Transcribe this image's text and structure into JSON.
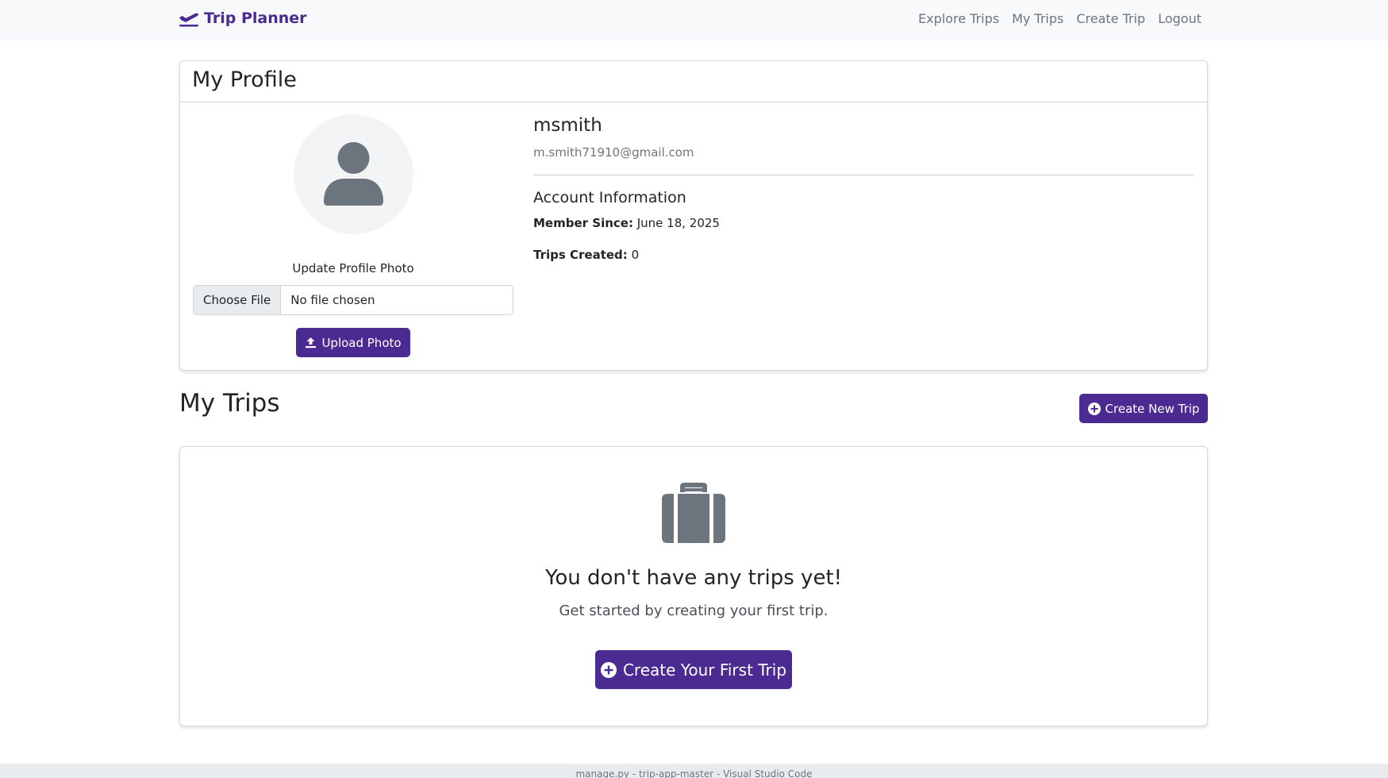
{
  "navbar": {
    "brand": "Trip Planner",
    "links": [
      "Explore Trips",
      "My Trips",
      "Create Trip",
      "Logout"
    ]
  },
  "profile": {
    "header": "My Profile",
    "username": "msmith",
    "email": "m.smith71910@gmail.com",
    "photo_label": "Update Profile Photo",
    "file_button": "Choose File",
    "file_status": "No file chosen",
    "upload_button": "Upload Photo",
    "account_title": "Account Information",
    "member_since_label": "Member Since:",
    "member_since_value": "June 18, 2025",
    "trips_created_label": "Trips Created:",
    "trips_created_value": "0"
  },
  "trips": {
    "title": "My Trips",
    "create_new_button": "Create New Trip",
    "empty_title": "You don't have any trips yet!",
    "empty_subtitle": "Get started by creating your first trip.",
    "first_trip_button": "Create Your First Trip"
  },
  "footer": {
    "text": "manage.py - trip-app-master - Visual Studio Code"
  },
  "colors": {
    "brand": "#4b2a91",
    "nav_bg": "#f8f9fa",
    "muted": "#6c757d"
  }
}
